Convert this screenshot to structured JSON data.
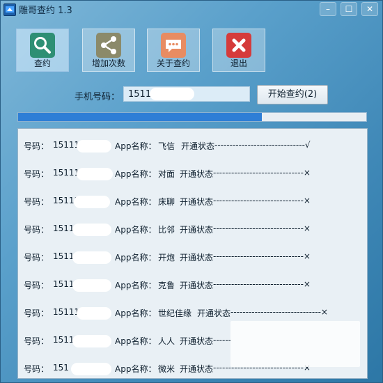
{
  "window": {
    "title": "雕哥查约 1.3",
    "controls": [
      "–",
      "☐",
      "✕"
    ]
  },
  "toolbar": {
    "items": [
      {
        "label": "查约",
        "icon": "search-icon",
        "color": "#2e8f74"
      },
      {
        "label": "增加次数",
        "icon": "share-icon",
        "color": "#8b8a6a"
      },
      {
        "label": "关于查约",
        "icon": "chat-icon",
        "color": "#e88c62"
      },
      {
        "label": "退出",
        "icon": "close-icon",
        "color": "#d53b3b"
      }
    ]
  },
  "phone": {
    "label": "手机号码：",
    "value": "1511"
  },
  "start_button": {
    "label": "开始查约(2)"
  },
  "progress": {
    "percent": 70
  },
  "results": {
    "rows": [
      {
        "number_label": "号码：",
        "number": "15111",
        "app_label": "App名称：",
        "app": "飞信",
        "status_label": "开通状态",
        "status_value": "------------------------------√"
      },
      {
        "number_label": "号码：",
        "number": "15111",
        "app_label": "App名称：",
        "app": "对面",
        "status_label": "开通状态",
        "status_value": "------------------------------×"
      },
      {
        "number_label": "号码：",
        "number": "15111",
        "app_label": "App名称：",
        "app": "床聊",
        "status_label": "开通状态",
        "status_value": "------------------------------×"
      },
      {
        "number_label": "号码：",
        "number": "1511",
        "app_label": "App名称：",
        "app": "比邻",
        "status_label": "开通状态",
        "status_value": "------------------------------×"
      },
      {
        "number_label": "号码：",
        "number": "1511",
        "app_label": "App名称：",
        "app": "开炮",
        "status_label": "开通状态",
        "status_value": "------------------------------×"
      },
      {
        "number_label": "号码：",
        "number": "1511",
        "app_label": "App名称：",
        "app": "克鲁",
        "status_label": "开通状态",
        "status_value": "------------------------------×"
      },
      {
        "number_label": "号码：",
        "number": "15111",
        "app_label": "App名称：",
        "app": "世纪佳缘",
        "status_label": "开通状态",
        "status_value": "------------------------------×"
      },
      {
        "number_label": "号码：",
        "number": "1511",
        "app_label": "App名称：",
        "app": "人人",
        "status_label": "开通状态",
        "status_value": "------"
      },
      {
        "number_label": "号码：",
        "number": "151",
        "app_label": "App名称：",
        "app": "微米",
        "status_label": "开通状态",
        "status_value": "------------------------------×"
      }
    ]
  }
}
